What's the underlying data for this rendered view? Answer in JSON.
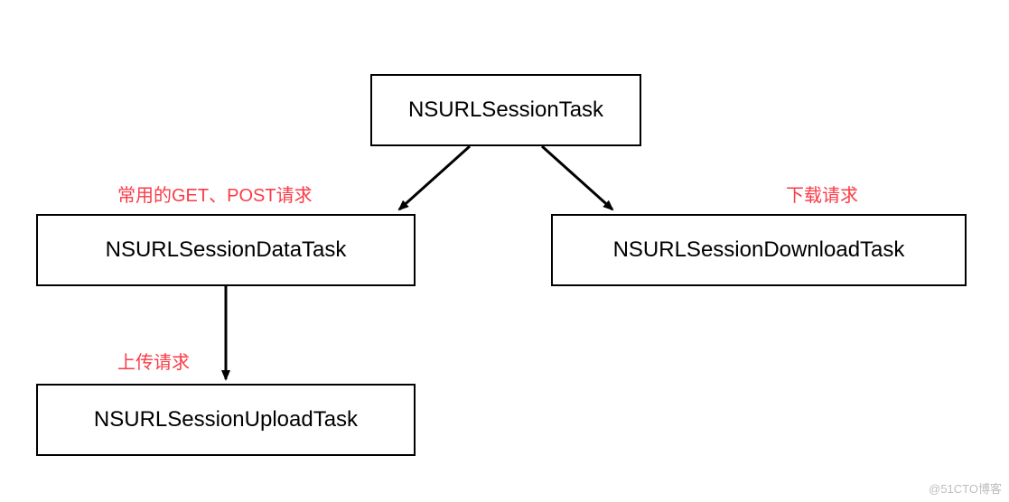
{
  "nodes": {
    "root": "NSURLSessionTask",
    "data_task": "NSURLSessionDataTask",
    "download_task": "NSURLSessionDownloadTask",
    "upload_task": "NSURLSessionUploadTask"
  },
  "annotations": {
    "get_post": "常用的GET、POST请求",
    "download": "下载请求",
    "upload": "上传请求"
  },
  "colors": {
    "annotation": "#fb3b47",
    "border": "#000000"
  },
  "watermark": "@51CTO博客"
}
